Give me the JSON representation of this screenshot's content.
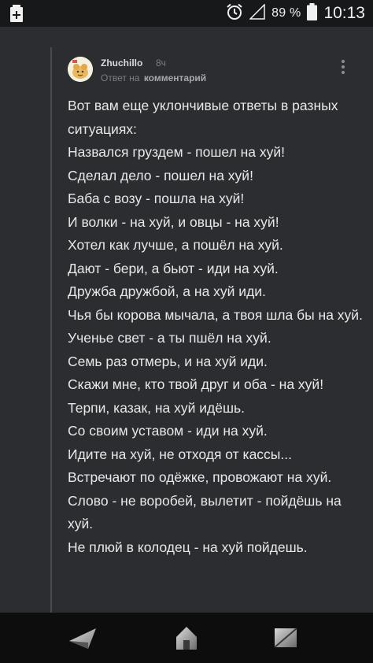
{
  "status_bar": {
    "battery_percent": "89 %",
    "time": "10:13",
    "left_icon": "battery-saver-icon",
    "icons": [
      "alarm-icon",
      "signal-icon",
      "battery-icon"
    ]
  },
  "comment": {
    "username": "Zhuchillo",
    "time_ago": "8ч",
    "reply_prefix": "Ответ на",
    "reply_target": "комментарий",
    "menu_icon": "more-vertical-icon",
    "lines": [
      "Вот вам еще уклончивые ответы в разных ситуациях:",
      "Назвался груздем - пошел на хуй!",
      "Сделал дело - пошел на хуй!",
      "Баба с возу - пошла на хуй!",
      "И волки - на хуй, и овцы - на хуй!",
      "Хотел как лучше, а пошёл на хуй.",
      "Дают - бери, а бьют - иди на хуй.",
      "Дружба дружбой, а на хуй иди.",
      "Чья бы корова мычала, а твоя шла бы на хуй.",
      "Ученье свет - а ты пшёл на хуй.",
      "Семь раз отмерь, и на хуй иди.",
      "Скажи мне, кто твой друг и оба - на хуй!",
      "Терпи, казак, на хуй идёшь.",
      "Со своим уставом - иди на хуй.",
      "Идите на хуй, не отходя от кассы...",
      "Встречают по одёжке, провожают на хуй.",
      "Слово - не воробей, вылетит - пойдёшь на хуй.",
      "Не плюй в колодец - на хуй пойдешь."
    ]
  },
  "nav_bar": {
    "icons": [
      "back-icon",
      "home-icon",
      "recents-icon"
    ]
  },
  "colors": {
    "background": "#2c2d30",
    "status_bar": "#17181a",
    "nav_bar": "#0d0d0e",
    "text": "#e8e8e8",
    "muted": "#7b7d80"
  }
}
